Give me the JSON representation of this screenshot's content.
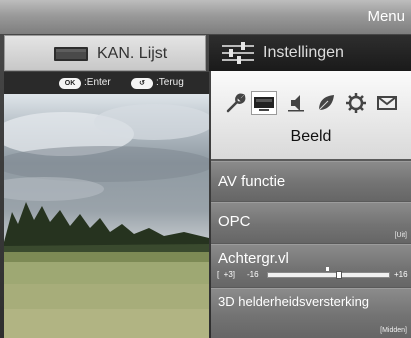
{
  "header": {
    "title": "Menu"
  },
  "tabs": {
    "channels": {
      "label": "KAN. Lijst",
      "icon": "tv-icon"
    },
    "settings": {
      "label": "Instellingen",
      "icon": "sliders-icon"
    }
  },
  "hints": {
    "enter": {
      "key": "OK",
      "label": ":Enter"
    },
    "back": {
      "key": "return",
      "label": ":Terug"
    }
  },
  "categories": {
    "items": [
      {
        "name": "setup",
        "icon": "wrench-icon"
      },
      {
        "name": "picture",
        "icon": "monitor-icon",
        "selected": true
      },
      {
        "name": "audio",
        "icon": "speaker-icon"
      },
      {
        "name": "eco",
        "icon": "leaf-icon"
      },
      {
        "name": "options",
        "icon": "gear-icon"
      },
      {
        "name": "messages",
        "icon": "envelope-icon"
      }
    ],
    "selected_label": "Beeld"
  },
  "menu_items": {
    "av": {
      "label": "AV functie"
    },
    "opc": {
      "label": "OPC",
      "value": "[Uit]"
    },
    "backlight": {
      "label": "Achtergr.vl",
      "current": "[  +3]",
      "min_label": "-16",
      "max_label": "+16",
      "level": 3,
      "range": [
        -16,
        16
      ]
    },
    "brightness3d": {
      "label": "3D helderheidsversterking",
      "value": "[Midden]"
    }
  },
  "colors": {
    "accent_dark": "#1e1e1e",
    "panel_light": "#f2f2f2",
    "item_gray": "#7a7a7a"
  }
}
